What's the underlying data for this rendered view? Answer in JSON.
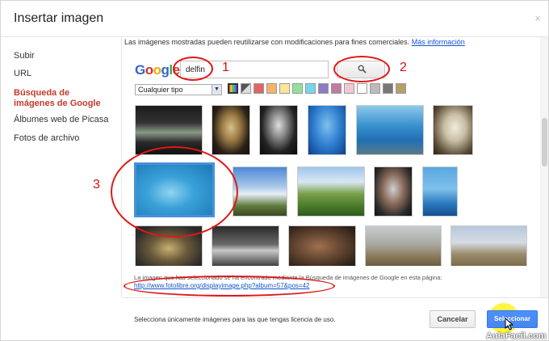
{
  "dialog": {
    "title": "Insertar imagen",
    "close_icon": "×"
  },
  "sidebar": {
    "items": [
      {
        "label": "Subir",
        "active": false
      },
      {
        "label": "URL",
        "active": false
      },
      {
        "label": "Búsqueda de imágenes de Google",
        "active": true
      },
      {
        "label": "Álbumes web de Picasa",
        "active": false
      },
      {
        "label": "Fotos de archivo",
        "active": false
      }
    ]
  },
  "notice": {
    "text": "Las imágenes mostradas pueden reutilizarse con modificaciones para fines comerciales.",
    "link": "Más información"
  },
  "search": {
    "logo": "Google",
    "query": "delfin",
    "button_icon": "search-icon"
  },
  "filters": {
    "type_selected": "Cualquier tipo",
    "colors": [
      "#444444",
      "#dddddd",
      "#e06666",
      "#f6b26b",
      "#ffe599",
      "#93e196",
      "#76d7ea",
      "#8e7cc3",
      "#c27ba0",
      "#ffffff",
      "#bbbbbb",
      "#777777",
      "#b6a06a"
    ]
  },
  "source": {
    "text": "La imagen que has seleccionado se ha encontrado mediante la Búsqueda de imágenes de Google en esta página:",
    "link": "http://www.fotolibre.org/displayimage.php?album=57&pos=42"
  },
  "footer": {
    "notice": "Selecciona únicamente imágenes para las que tengas licencia de uso.",
    "cancel_label": "Cancelar",
    "select_label": "Seleccionar"
  },
  "annotations": [
    "1",
    "2",
    "3"
  ],
  "watermark": "AulaFacil.com",
  "colors": {
    "link": "#1155cc",
    "active_nav": "#c53929",
    "primary_button": "#4d90fe",
    "annotation": "#e01818"
  }
}
